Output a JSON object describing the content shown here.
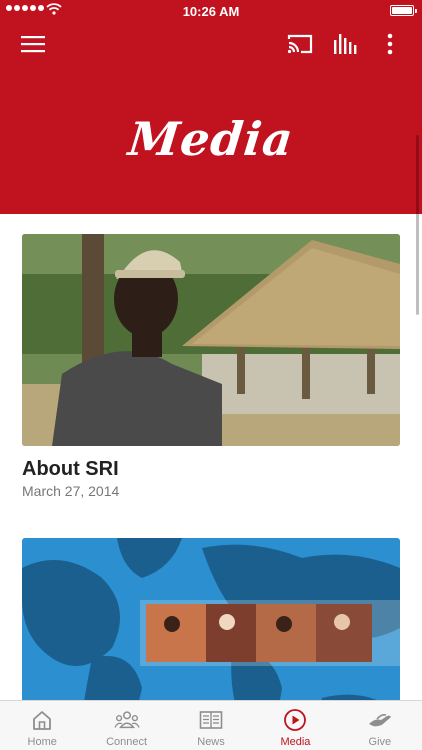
{
  "status_bar": {
    "time": "10:26 AM"
  },
  "header": {
    "title": "Media"
  },
  "cards": [
    {
      "title": "About SRI",
      "date": "March 27, 2014"
    },
    {
      "title": "",
      "date": ""
    }
  ],
  "tabs": [
    {
      "label": "Home",
      "icon": "home-icon"
    },
    {
      "label": "Connect",
      "icon": "people-icon"
    },
    {
      "label": "News",
      "icon": "newspaper-icon"
    },
    {
      "label": "Media",
      "icon": "play-circle-icon",
      "active": true
    },
    {
      "label": "Give",
      "icon": "hand-icon"
    }
  ],
  "colors": {
    "brand": "#c1121f",
    "tab_inactive": "#8e8e8e"
  }
}
